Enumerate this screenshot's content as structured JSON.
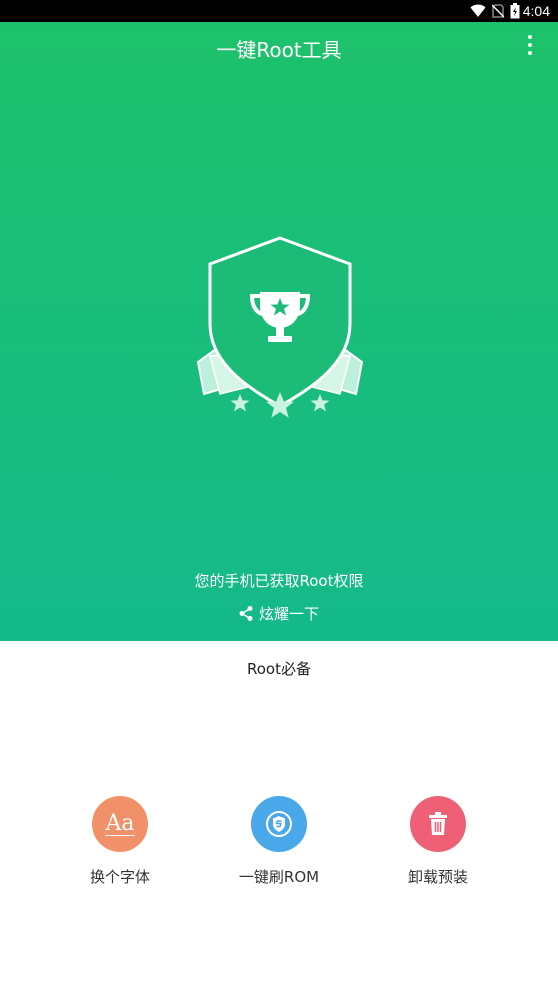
{
  "status_bar": {
    "time": "4:04",
    "wifi_icon": "wifi-icon",
    "sim_icon": "no-sim-icon",
    "battery_icon": "battery-charging-icon"
  },
  "app_bar": {
    "title": "一键Root工具",
    "menu_icon": "more-vert-icon"
  },
  "hero": {
    "badge_icon": "trophy-shield-icon",
    "status_text": "您的手机已获取Root权限",
    "share_label": "炫耀一下",
    "share_icon": "share-icon",
    "colors": {
      "gradient_top": "#1ec16b",
      "gradient_bottom": "#14b98b"
    }
  },
  "essentials": {
    "title": "Root必备",
    "tools": [
      {
        "label": "换个字体",
        "icon": "font-icon",
        "glyph": "Aa",
        "color": "#f0916a"
      },
      {
        "label": "一键刷ROM",
        "icon": "shield-s-icon",
        "color": "#4aa7ea"
      },
      {
        "label": "卸载预装",
        "icon": "trash-icon",
        "color": "#ef6077"
      }
    ]
  }
}
